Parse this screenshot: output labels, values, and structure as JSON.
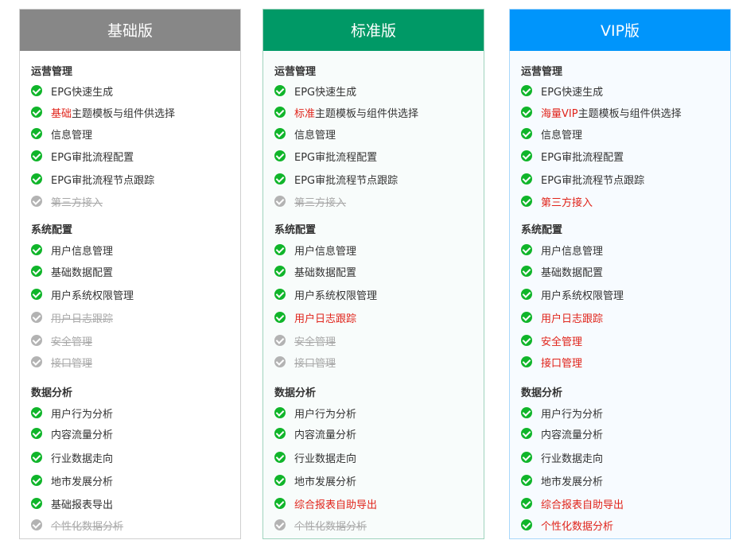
{
  "plans": [
    {
      "title": "基础版",
      "header_color": "#878787",
      "sections": [
        {
          "title": "运营管理",
          "items": [
            {
              "text": "EPG快速生成",
              "state": "on"
            },
            {
              "pre": "基础",
              "text": "主题模板与组件供选择",
              "state": "on"
            },
            {
              "text": "信息管理",
              "state": "on"
            },
            {
              "text": "EPG审批流程配置",
              "state": "on"
            },
            {
              "text": "EPG审批流程节点跟踪",
              "state": "on"
            },
            {
              "text": "第三方接入",
              "state": "off"
            }
          ]
        },
        {
          "title": "系统配置",
          "items": [
            {
              "text": "用户信息管理",
              "state": "on"
            },
            {
              "text": "基础数据配置",
              "state": "on"
            },
            {
              "text": "用户系统权限管理",
              "state": "on"
            },
            {
              "text": "用户日志跟踪",
              "state": "off"
            },
            {
              "text": "安全管理",
              "state": "off"
            },
            {
              "text": "接口管理",
              "state": "off"
            }
          ]
        },
        {
          "title": "数据分析",
          "items": [
            {
              "text": "用户行为分析",
              "state": "on"
            },
            {
              "text": "内容流量分析",
              "state": "on"
            },
            {
              "text": "行业数据走向",
              "state": "on"
            },
            {
              "text": "地市发展分析",
              "state": "on"
            },
            {
              "text": "基础报表导出",
              "state": "on"
            },
            {
              "text": "个性化数据分析",
              "state": "off"
            }
          ]
        }
      ]
    },
    {
      "title": "标准版",
      "header_color": "#009966",
      "sections": [
        {
          "title": "运营管理",
          "items": [
            {
              "text": "EPG快速生成",
              "state": "on"
            },
            {
              "pre": "标准",
              "text": "主题模板与组件供选择",
              "state": "on"
            },
            {
              "text": "信息管理",
              "state": "on"
            },
            {
              "text": "EPG审批流程配置",
              "state": "on"
            },
            {
              "text": "EPG审批流程节点跟踪",
              "state": "on"
            },
            {
              "text": "第三方接入",
              "state": "off"
            }
          ]
        },
        {
          "title": "系统配置",
          "items": [
            {
              "text": "用户信息管理",
              "state": "on"
            },
            {
              "text": "基础数据配置",
              "state": "on"
            },
            {
              "text": "用户系统权限管理",
              "state": "on"
            },
            {
              "text": "用户日志跟踪",
              "state": "red"
            },
            {
              "text": "安全管理",
              "state": "off"
            },
            {
              "text": "接口管理",
              "state": "off"
            }
          ]
        },
        {
          "title": "数据分析",
          "items": [
            {
              "text": "用户行为分析",
              "state": "on"
            },
            {
              "text": "内容流量分析",
              "state": "on"
            },
            {
              "text": "行业数据走向",
              "state": "on"
            },
            {
              "text": "地市发展分析",
              "state": "on"
            },
            {
              "text": "综合报表自助导出",
              "state": "red"
            },
            {
              "text": "个性化数据分析",
              "state": "off"
            }
          ]
        }
      ]
    },
    {
      "title": "VIP版",
      "header_color": "#0095fb",
      "sections": [
        {
          "title": "运营管理",
          "items": [
            {
              "text": "EPG快速生成",
              "state": "on"
            },
            {
              "pre": "海量VIP",
              "text": "主题模板与组件供选择",
              "state": "on"
            },
            {
              "text": "信息管理",
              "state": "on"
            },
            {
              "text": "EPG审批流程配置",
              "state": "on"
            },
            {
              "text": "EPG审批流程节点跟踪",
              "state": "on"
            },
            {
              "text": "第三方接入",
              "state": "red"
            }
          ]
        },
        {
          "title": "系统配置",
          "items": [
            {
              "text": "用户信息管理",
              "state": "on"
            },
            {
              "text": "基础数据配置",
              "state": "on"
            },
            {
              "text": "用户系统权限管理",
              "state": "on"
            },
            {
              "text": "用户日志跟踪",
              "state": "red"
            },
            {
              "text": "安全管理",
              "state": "red"
            },
            {
              "text": "接口管理",
              "state": "red"
            }
          ]
        },
        {
          "title": "数据分析",
          "items": [
            {
              "text": "用户行为分析",
              "state": "on"
            },
            {
              "text": "内容流量分析",
              "state": "on"
            },
            {
              "text": "行业数据走向",
              "state": "on"
            },
            {
              "text": "地市发展分析",
              "state": "on"
            },
            {
              "text": "综合报表自助导出",
              "state": "red"
            },
            {
              "text": "个性化数据分析",
              "state": "red"
            }
          ]
        }
      ]
    }
  ],
  "colors": {
    "check_on": "#10b52a",
    "check_off": "#b3b3b3",
    "highlight": "#e0241b"
  }
}
